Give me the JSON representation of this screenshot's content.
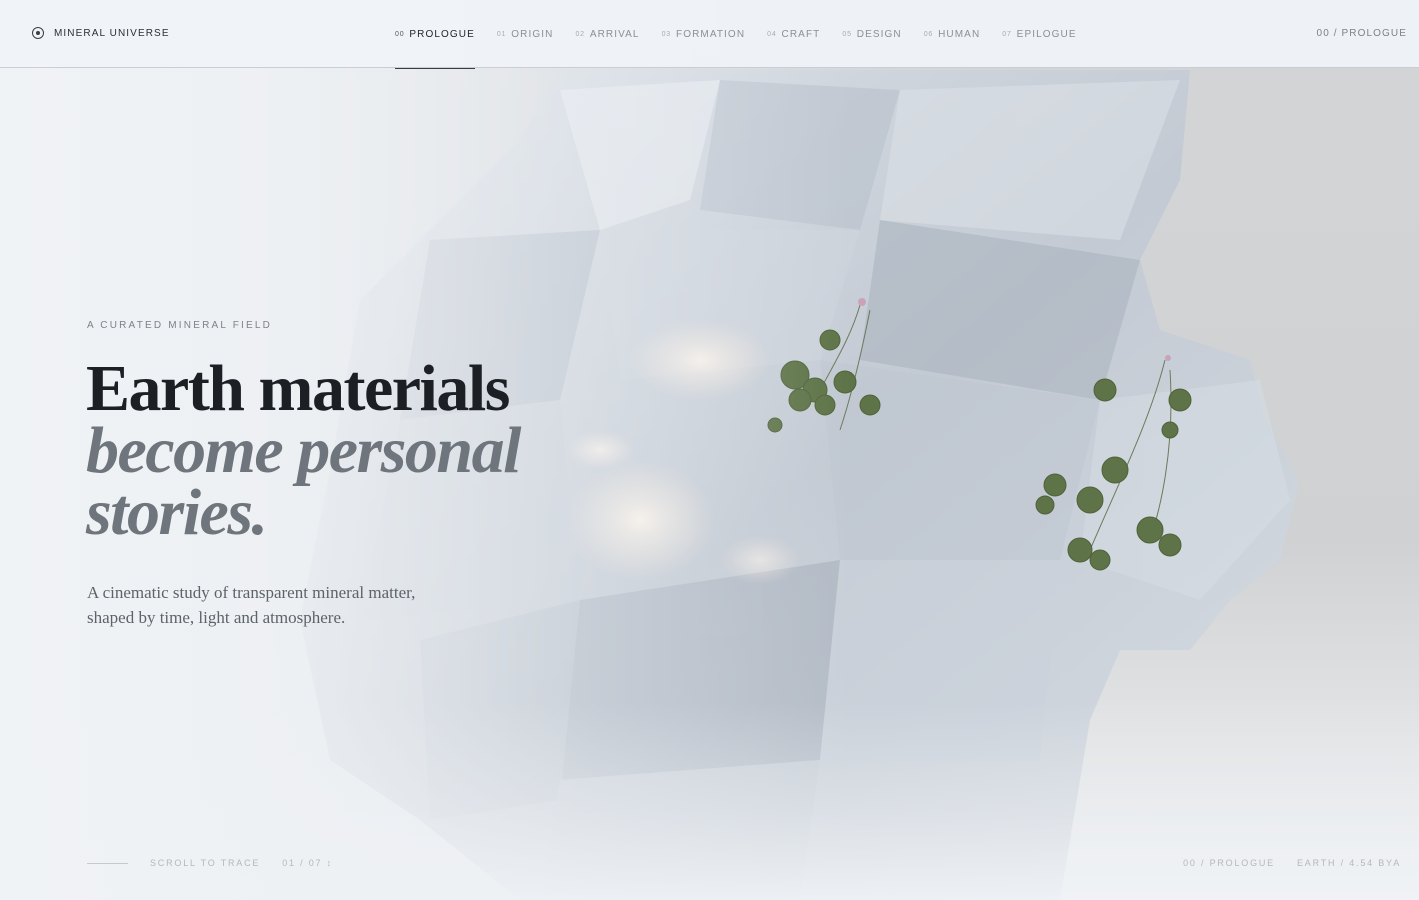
{
  "brand": {
    "icon": "target-icon",
    "name": "MINERAL UNIVERSE"
  },
  "nav": {
    "items": [
      {
        "num": "00",
        "label": "PROLOGUE",
        "active": true
      },
      {
        "num": "01",
        "label": "ORIGIN",
        "active": false
      },
      {
        "num": "02",
        "label": "ARRIVAL",
        "active": false
      },
      {
        "num": "03",
        "label": "FORMATION",
        "active": false
      },
      {
        "num": "04",
        "label": "CRAFT",
        "active": false
      },
      {
        "num": "05",
        "label": "DESIGN",
        "active": false
      },
      {
        "num": "06",
        "label": "HUMAN",
        "active": false
      },
      {
        "num": "07",
        "label": "EPILOGUE",
        "active": false
      }
    ],
    "breadcrumb": "00 / PROLOGUE"
  },
  "hero": {
    "eyebrow": "A CURATED MINERAL FIELD",
    "headline_line1": "Earth materials",
    "headline_line2": "become personal",
    "headline_line3": "stories.",
    "lede": "A cinematic study of transparent mineral matter, shaped by time, light and atmosphere."
  },
  "footer": {
    "scroll_label": "SCROLL TO TRACE",
    "progress": "01 / 07",
    "progress_glyph": "↕",
    "section": "00 / PROLOGUE",
    "epoch": "EARTH / 4.54 BYA"
  },
  "colors": {
    "text_dark": "#1c2025",
    "text_muted": "#6f757c",
    "crystal_light": "#e9edf3",
    "crystal_shadow": "#9aa3b0",
    "clover": "#5e7347",
    "warm_highlight": "#f6eadf"
  }
}
